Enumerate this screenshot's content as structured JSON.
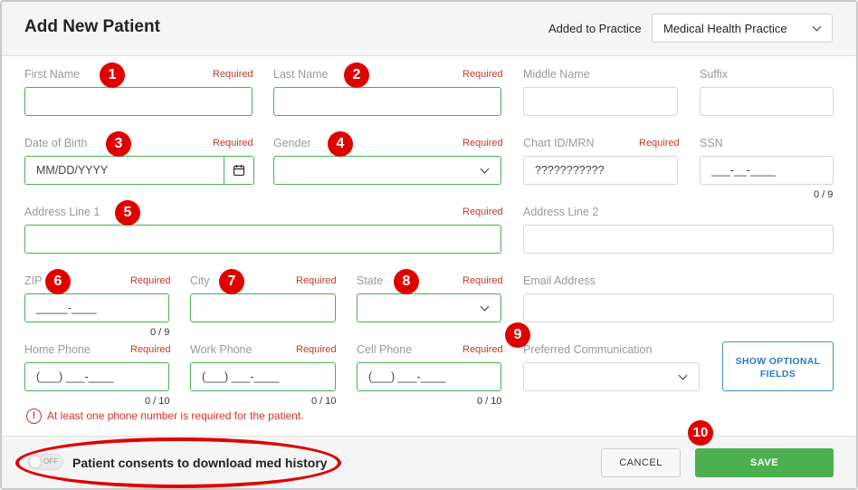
{
  "header": {
    "title": "Add New Patient",
    "practice_label": "Added to Practice",
    "practice_value": "Medical Health Practice"
  },
  "fields": {
    "first_name": {
      "label": "First Name",
      "required": "Required"
    },
    "last_name": {
      "label": "Last Name",
      "required": "Required"
    },
    "middle_name": {
      "label": "Middle Name"
    },
    "suffix": {
      "label": "Suffix"
    },
    "dob": {
      "label": "Date of Birth",
      "required": "Required",
      "placeholder": "MM/DD/YYYY"
    },
    "gender": {
      "label": "Gender",
      "required": "Required"
    },
    "chart_id": {
      "label": "Chart ID/MRN",
      "required": "Required",
      "value": "???????????"
    },
    "ssn": {
      "label": "SSN",
      "placeholder": "___-__-____",
      "counter": "0 / 9"
    },
    "address1": {
      "label": "Address Line 1",
      "required": "Required"
    },
    "address2": {
      "label": "Address Line 2"
    },
    "zip": {
      "label": "ZIP",
      "required": "Required",
      "placeholder": "_____-____",
      "counter": "0 / 9"
    },
    "city": {
      "label": "City",
      "required": "Required"
    },
    "state": {
      "label": "State",
      "required": "Required"
    },
    "email": {
      "label": "Email Address"
    },
    "home_phone": {
      "label": "Home Phone",
      "required": "Required",
      "placeholder": "(___) ___-____",
      "counter": "0 / 10"
    },
    "work_phone": {
      "label": "Work Phone",
      "required": "Required",
      "placeholder": "(___) ___-____",
      "counter": "0 / 10"
    },
    "cell_phone": {
      "label": "Cell Phone",
      "required": "Required",
      "placeholder": "(___) ___-____",
      "counter": "0 / 10"
    },
    "preferred_comm": {
      "label": "Preferred Communication"
    }
  },
  "buttons": {
    "show_optional": "SHOW OPTIONAL FIELDS",
    "cancel": "CANCEL",
    "save": "SAVE"
  },
  "error_message": "At least one phone number is required for the patient.",
  "footer": {
    "toggle_state": "OFF",
    "consent_text": "Patient consents to download med history"
  },
  "badges": [
    "1",
    "2",
    "3",
    "4",
    "5",
    "6",
    "7",
    "8",
    "9",
    "10"
  ],
  "colors": {
    "required_red": "#c0392b",
    "valid_green": "#4caf50",
    "save_green": "#4cb050",
    "badge_red": "#e00000",
    "link_blue": "#2a7bbf"
  }
}
